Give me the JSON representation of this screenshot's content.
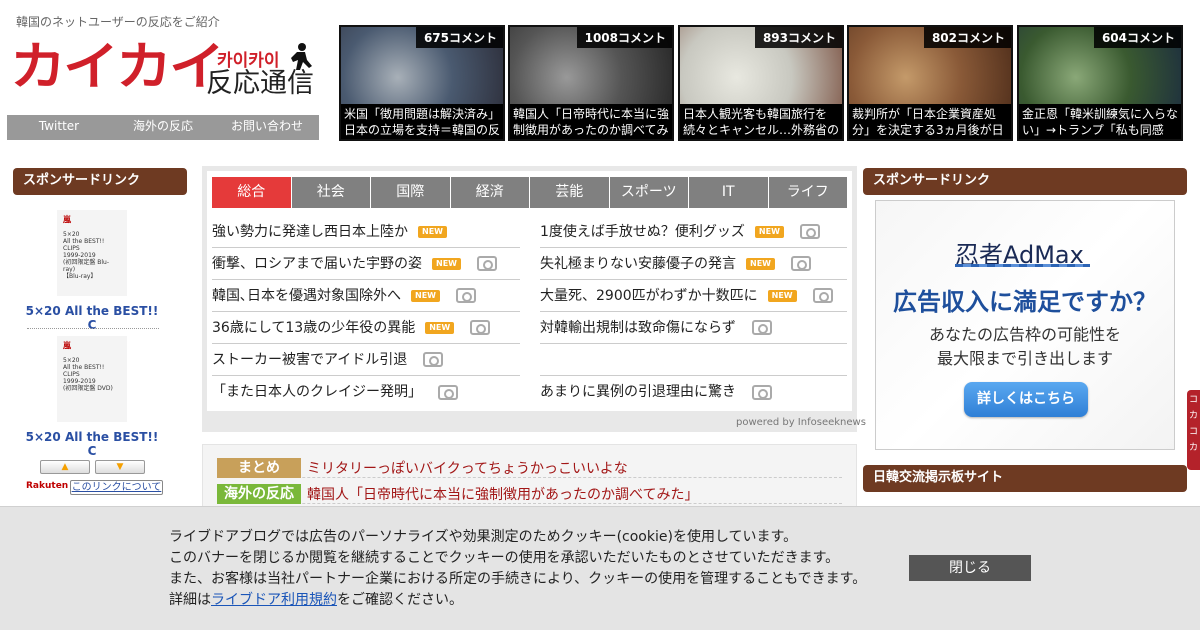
{
  "header": {
    "tagline": "韓国のネットユーザーの反応をご紹介",
    "logo_main": "カイカイ",
    "logo_kana": "카이카이",
    "logo_sub": "反応通信"
  },
  "nav": [
    "Twitter",
    "海外の反応",
    "お問い合わせ"
  ],
  "top_stories": [
    {
      "count": "675コメント",
      "caption": "米国「徴用問題は解決済み」日本の立場を支持＝韓国の反",
      "colors": [
        "#4a5a70",
        "#a8b0b8",
        "#2a2a35"
      ]
    },
    {
      "count": "1008コメント",
      "caption": "韓国人「日帝時代に本当に強制徴用があったのか調べてみ",
      "colors": [
        "#555",
        "#999",
        "#222"
      ]
    },
    {
      "count": "893コメント",
      "caption": "日本人観光客も韓国旅行を続々とキャンセル…外務省の",
      "colors": [
        "#c8c8c0",
        "#e8e8e0",
        "#7a5040"
      ]
    },
    {
      "count": "802コメント",
      "caption": "裁判所が「日本企業資産処分」を決定する3ヵ月後が日",
      "colors": [
        "#8a5a38",
        "#c49a6a",
        "#4a2a18"
      ]
    },
    {
      "count": "604コメント",
      "caption": "金正恩「韓米訓練気に入らない」→トランプ「私も同感",
      "colors": [
        "#3a5a30",
        "#8aa878",
        "#1a2a40"
      ]
    }
  ],
  "left_sidebar": {
    "heading": "スポンサードリンク",
    "products": [
      {
        "title": "5×20 All the BEST!! C",
        "cover_brand": "嵐",
        "cover_lines": [
          "5×20",
          "All the BEST!!",
          "CLIPS",
          "1999-2019",
          "(初回限定盤 Blu-ray)",
          "【Blu-ray】"
        ]
      },
      {
        "title": "5×20 All the BEST!! C",
        "cover_brand": "嵐",
        "cover_lines": [
          "5×20",
          "All the BEST!!",
          "CLIPS",
          "1999-2019",
          "(初回限定盤 DVD)"
        ]
      }
    ],
    "up_arrow": "▲",
    "down_arrow": "▼",
    "rakuten_label": "Rakuten",
    "about_link": "このリンクについて"
  },
  "news": {
    "tabs": [
      "総合",
      "社会",
      "国際",
      "経済",
      "芸能",
      "スポーツ",
      "IT",
      "ライフ"
    ],
    "active_tab": "総合",
    "new_label": "NEW",
    "left": [
      {
        "text": "強い勢力に発達し西日本上陸か",
        "new": true,
        "photo": false
      },
      {
        "text": "衝撃、ロシアまで届いた宇野の姿",
        "new": true,
        "photo": true
      },
      {
        "text": "韓国､日本を優遇対象国除外へ",
        "new": true,
        "photo": true
      },
      {
        "text": "36歳にして13歳の少年役の異能",
        "new": true,
        "photo": true
      },
      {
        "text": "ストーカー被害でアイドル引退",
        "new": false,
        "photo": true
      },
      {
        "text": "「また日本人のクレイジー発明」",
        "new": false,
        "photo": true
      }
    ],
    "right": [
      {
        "text": "1度使えば手放せぬ？便利グッズ",
        "new": true,
        "photo": true
      },
      {
        "text": "失礼極まりない安藤優子の発言",
        "new": true,
        "photo": true
      },
      {
        "text": "大量死、2900匹がわずか十数匹に",
        "new": true,
        "photo": true
      },
      {
        "text": "対韓輸出規制は致命傷にならず",
        "new": false,
        "photo": true
      },
      {
        "text": "",
        "new": false,
        "photo": false
      },
      {
        "text": "あまりに異例の引退理由に驚き",
        "new": false,
        "photo": true
      }
    ],
    "powered_by": "powered by Infoseeknews"
  },
  "matome": [
    {
      "tag": "まとめ",
      "tag_color": "#c8a05a",
      "text": "ミリタリーっぽいバイクってちょうかっこいいよな"
    },
    {
      "tag": "海外の反応",
      "tag_color": "#7ab83a",
      "text": "韓国人「日帝時代に本当に強制徴用があったのか調べてみた」"
    }
  ],
  "right_sidebar": {
    "heading": "スポンサードリンク",
    "ad": {
      "brand": "忍者AdMax",
      "headline": "広告収入に満足ですか？",
      "body": [
        "あなたの広告枠の可能性を",
        "最大限まで引き出します"
      ],
      "button": "詳しくはこちら"
    },
    "heading2": "日韓交流掲示板サイト",
    "side_tab": [
      "コ",
      "カ",
      "コ",
      "カ"
    ]
  },
  "cookie_banner": {
    "lines": [
      "ライブドアブログでは広告のパーソナライズや効果測定のためクッキー(cookie)を使用しています。",
      "このバナーを閉じるか閲覧を継続することでクッキーの使用を承認いただいたものとさせていただきます。",
      "また、お客様は当社パートナー企業における所定の手続きにより、クッキーの使用を管理することもできます。"
    ],
    "details_prefix": "詳細は",
    "details_link": "ライブドア利用規約",
    "details_suffix": "をご確認ください。",
    "close": "閉じる"
  },
  "colors": {
    "brand_red": "#d0202a",
    "tab_active": "#e53a3a",
    "tab_inactive": "#808080",
    "sidebar_header": "#6e3a22",
    "new_badge": "#f1a61f"
  }
}
